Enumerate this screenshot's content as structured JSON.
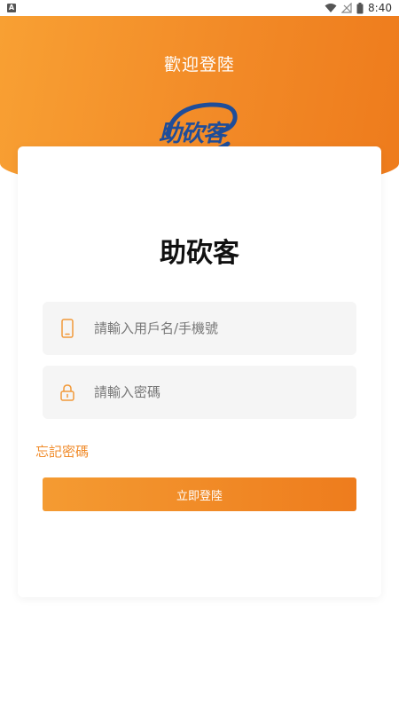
{
  "status_bar": {
    "notification_badge": "A",
    "time": "8:40"
  },
  "header": {
    "welcome_text": "歡迎登陸",
    "logo_text": "助砍客"
  },
  "card": {
    "app_title": "助砍客",
    "username": {
      "placeholder": "請輸入用戶名/手機號",
      "value": ""
    },
    "password": {
      "placeholder": "請輸入密碼",
      "value": ""
    },
    "forgot_password_label": "忘記密碼",
    "login_button_label": "立即登陸"
  },
  "colors": {
    "brand_orange": "#f28a27",
    "logo_blue": "#1f4d99",
    "field_bg": "#f5f5f5"
  }
}
